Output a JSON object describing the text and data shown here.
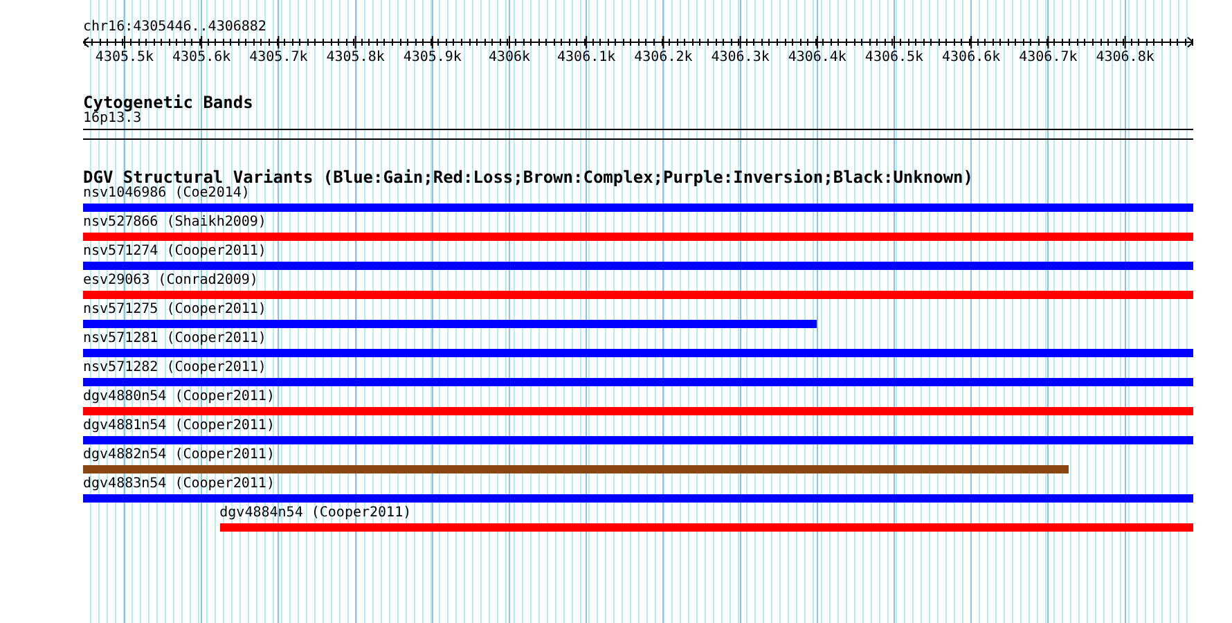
{
  "ruler": {
    "title": "chr16:4305446..4306882",
    "ticks": [
      "4305.5k",
      "4305.6k",
      "4305.7k",
      "4305.8k",
      "4305.9k",
      "4306k",
      "4306.1k",
      "4306.2k",
      "4306.3k",
      "4306.4k",
      "4306.5k",
      "4306.6k",
      "4306.7k",
      "4306.8k"
    ]
  },
  "cytogenetic_bands": {
    "title": "Cytogenetic Bands",
    "band": "16p13.3"
  },
  "dgv_track": {
    "title": "DGV Structural Variants (Blue:Gain;Red:Loss;Brown:Complex;Purple:Inversion;Black:Unknown)",
    "features": [
      {
        "label": "nsv1046986 (Coe2014)",
        "color": "#0000ff",
        "kind": "leading",
        "level": 1
      },
      {
        "label": "nsv527866 (Shaikh2009)",
        "color": "#ff0000",
        "kind": "leading",
        "level": 1
      },
      {
        "label": "nsv571274 (Cooper2011)",
        "color": "#0000ff",
        "kind": "leading",
        "level": 1
      },
      {
        "label": "esv29063 (Conrad2009)",
        "color": "#ff0000",
        "kind": "leading",
        "level": 1
      },
      {
        "label": "nsv571275 (Cooper2011)",
        "color": "#0000ff",
        "kind": "leading",
        "level": 0.661
      },
      {
        "label": "nsv571281 (Cooper2011)",
        "color": "#0000ff",
        "kind": "leading",
        "level": 1
      },
      {
        "label": "nsv571282 (Cooper2011)",
        "color": "#0000ff",
        "kind": "leading",
        "level": 1
      },
      {
        "label": "dgv4880n54 (Cooper2011)",
        "color": "#ff0000",
        "kind": "leading",
        "level": 1
      },
      {
        "label": "dgv4881n54 (Cooper2011)",
        "color": "#0000ff",
        "kind": "leading",
        "level": 1
      },
      {
        "label": "dgv4882n54 (Cooper2011)",
        "color": "#8b4513",
        "kind": "leading",
        "level": 0.888
      },
      {
        "label": "dgv4883n54 (Cooper2011)",
        "color": "#0000ff",
        "kind": "leading",
        "level": 1
      },
      {
        "label": "dgv4884n54 (Cooper2011)",
        "color": "#ff0000",
        "kind": "trailing",
        "level": 0.877
      }
    ]
  }
}
